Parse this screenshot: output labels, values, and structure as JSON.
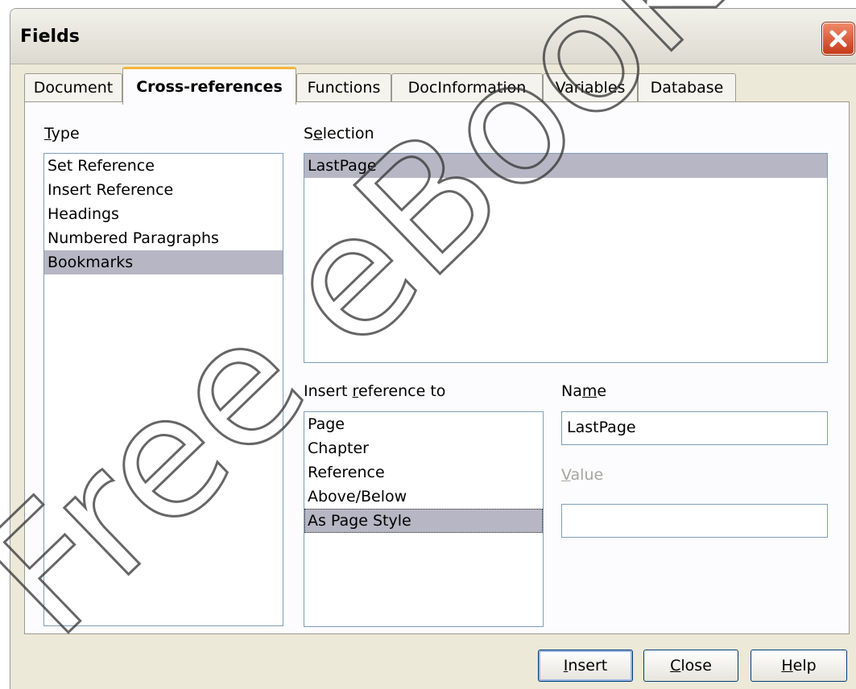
{
  "window": {
    "title": "Fields"
  },
  "tabs": [
    {
      "label": "Document"
    },
    {
      "label": "Cross-references",
      "active": true
    },
    {
      "label": "Functions"
    },
    {
      "label": "DocInformation"
    },
    {
      "label": "Variables"
    },
    {
      "label": "Database"
    }
  ],
  "type": {
    "label_pre": "",
    "label_key": "T",
    "label_post": "ype",
    "items": [
      "Set Reference",
      "Insert Reference",
      "Headings",
      "Numbered Paragraphs",
      "Bookmarks"
    ],
    "selected": "Bookmarks"
  },
  "selection": {
    "label_pre": "S",
    "label_key": "e",
    "label_post": "lection",
    "items": [
      "LastPage"
    ],
    "selected": "LastPage"
  },
  "insert_ref": {
    "label_pre": "Insert ",
    "label_key": "r",
    "label_post": "eference to",
    "items": [
      "Page",
      "Chapter",
      "Reference",
      "Above/Below",
      "As Page Style"
    ],
    "selected": "As Page Style"
  },
  "name": {
    "label_pre": "Na",
    "label_key": "m",
    "label_post": "e",
    "value": "LastPage"
  },
  "value": {
    "label_pre": "",
    "label_key": "V",
    "label_post": "alue",
    "value": ""
  },
  "buttons": {
    "insert_key": "I",
    "insert_rest": "nsert",
    "close_key": "C",
    "close_rest": "lose",
    "help_key": "H",
    "help_rest": "elp"
  },
  "watermark": {
    "text": "Free eBook Edition"
  },
  "colors": {
    "selection": "#b7b6c4",
    "tab_accent": "#f7b43a",
    "close_button": "#d9502a"
  }
}
